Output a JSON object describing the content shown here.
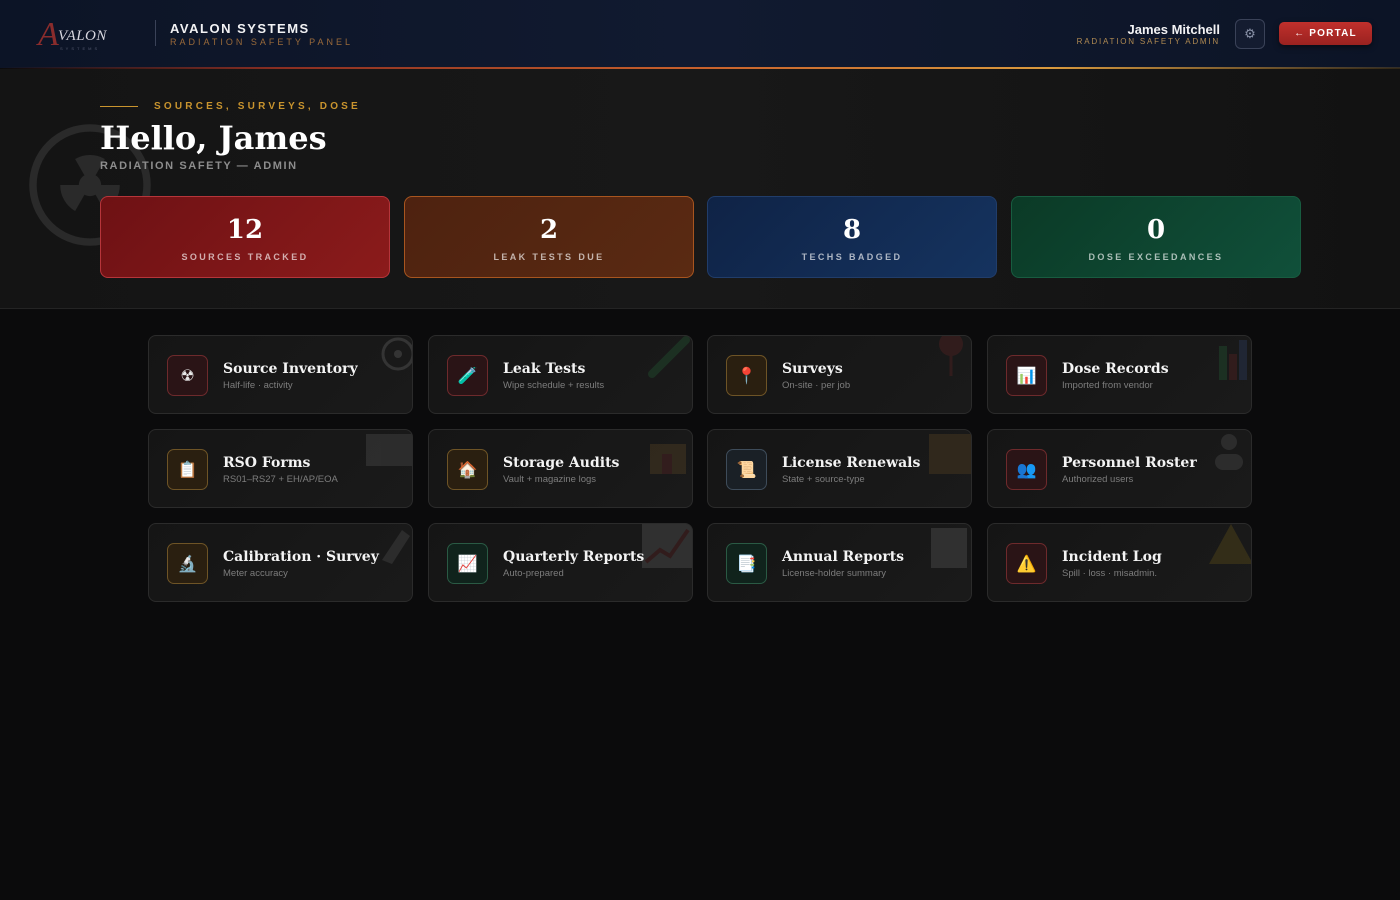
{
  "header": {
    "logo_letter": "A",
    "logo_text": "VALON",
    "logo_sub": "SYSTEMS",
    "brand_title": "AVALON SYSTEMS",
    "brand_subtitle": "RADIATION SAFETY PANEL",
    "user_name": "James Mitchell",
    "user_role": "RADIATION SAFETY ADMIN",
    "settings_icon": "gear-icon",
    "settings_glyph": "⚙",
    "portal_label": "← PORTAL"
  },
  "hero": {
    "eyebrow": "SOURCES, SURVEYS, DOSE",
    "greeting": "Hello, James",
    "role_line": "RADIATION SAFETY — ADMIN"
  },
  "stats": [
    {
      "value": "12",
      "label": "SOURCES TRACKED",
      "color": "#8b1b1b"
    },
    {
      "value": "2",
      "label": "LEAK TESTS DUE",
      "color": "#5a2a12"
    },
    {
      "value": "8",
      "label": "TECHS BADGED",
      "color": "#15335f"
    },
    {
      "value": "0",
      "label": "DOSE EXCEEDANCES",
      "color": "#10503a"
    }
  ],
  "cards": [
    {
      "title": "Source Inventory",
      "subtitle": "Half-life · activity",
      "icon": "radioactive-icon",
      "glyph": "☢"
    },
    {
      "title": "Leak Tests",
      "subtitle": "Wipe schedule + results",
      "icon": "test-tube-icon",
      "glyph": "🧪"
    },
    {
      "title": "Surveys",
      "subtitle": "On-site · per job",
      "icon": "map-pin-icon",
      "glyph": "📍"
    },
    {
      "title": "Dose Records",
      "subtitle": "Imported from vendor",
      "icon": "bar-chart-icon",
      "glyph": "📊"
    },
    {
      "title": "RSO Forms",
      "subtitle": "RS01–RS27 + EH/AP/EOA",
      "icon": "clipboard-icon",
      "glyph": "📋"
    },
    {
      "title": "Storage Audits",
      "subtitle": "Vault + magazine logs",
      "icon": "house-icon",
      "glyph": "🏠"
    },
    {
      "title": "License Renewals",
      "subtitle": "State + source-type",
      "icon": "scroll-icon",
      "glyph": "📜"
    },
    {
      "title": "Personnel Roster",
      "subtitle": "Authorized users",
      "icon": "people-icon",
      "glyph": "👥"
    },
    {
      "title": "Calibration · Survey",
      "subtitle": "Meter accuracy",
      "icon": "microscope-icon",
      "glyph": "🔬"
    },
    {
      "title": "Quarterly Reports",
      "subtitle": "Auto-prepared",
      "icon": "trend-chart-icon",
      "glyph": "📈"
    },
    {
      "title": "Annual Reports",
      "subtitle": "License-holder summary",
      "icon": "document-icon",
      "glyph": "📑"
    },
    {
      "title": "Incident Log",
      "subtitle": "Spill · loss · misadmin.",
      "icon": "warning-icon",
      "glyph": "⚠️"
    }
  ]
}
